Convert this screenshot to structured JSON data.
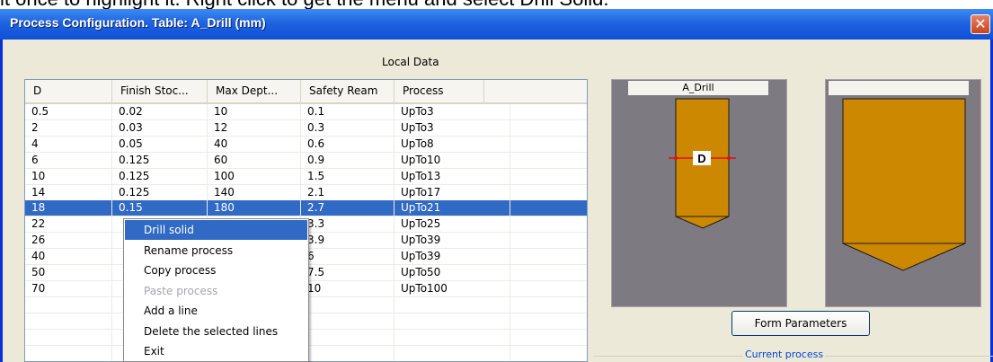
{
  "instruction": "it once to highlight it. Right click to get the menu and select Drill Solid.",
  "window": {
    "title": "Process Configuration. Table: A_Drill (mm)",
    "close_glyph": "✕"
  },
  "section_label": "Local Data",
  "table": {
    "columns": [
      "D",
      "Finish Stoc...",
      "Max Dept...",
      "Safety Ream",
      "Process"
    ],
    "rows": [
      [
        "0.5",
        "0.02",
        "10",
        "0.1",
        "UpTo3"
      ],
      [
        "2",
        "0.03",
        "12",
        "0.3",
        "UpTo3"
      ],
      [
        "4",
        "0.05",
        "40",
        "0.6",
        "UpTo8"
      ],
      [
        "6",
        "0.125",
        "60",
        "0.9",
        "UpTo10"
      ],
      [
        "10",
        "0.125",
        "100",
        "1.5",
        "UpTo13"
      ],
      [
        "14",
        "0.125",
        "140",
        "2.1",
        "UpTo17"
      ],
      [
        "18",
        "0.15",
        "180",
        "2.7",
        "UpTo21"
      ],
      [
        "22",
        "",
        "",
        "3.3",
        "UpTo25"
      ],
      [
        "26",
        "",
        "",
        "3.9",
        "UpTo39"
      ],
      [
        "40",
        "",
        "",
        "6",
        "UpTo39"
      ],
      [
        "50",
        "",
        "",
        "7.5",
        "UpTo50"
      ],
      [
        "70",
        "",
        "",
        "10",
        "UpTo100"
      ]
    ],
    "selected_row": 6
  },
  "context_menu": {
    "items": [
      {
        "label": "Drill solid",
        "state": "highlighted"
      },
      {
        "label": "Rename process",
        "state": "normal"
      },
      {
        "label": "Copy process",
        "state": "normal"
      },
      {
        "label": "Paste process",
        "state": "disabled"
      },
      {
        "label": "Add a line",
        "state": "normal"
      },
      {
        "label": "Delete the selected lines",
        "state": "normal"
      },
      {
        "label": "Exit",
        "state": "normal"
      }
    ]
  },
  "preview": {
    "tool_label": "A_Drill",
    "dimension_label": "D"
  },
  "form_button": "Form Parameters",
  "current_process_label": "Current process",
  "colors": {
    "tool": "#cc8800",
    "preview_bg": "#7d7a82",
    "selection": "#316ac5",
    "dimension": "#e01010"
  }
}
